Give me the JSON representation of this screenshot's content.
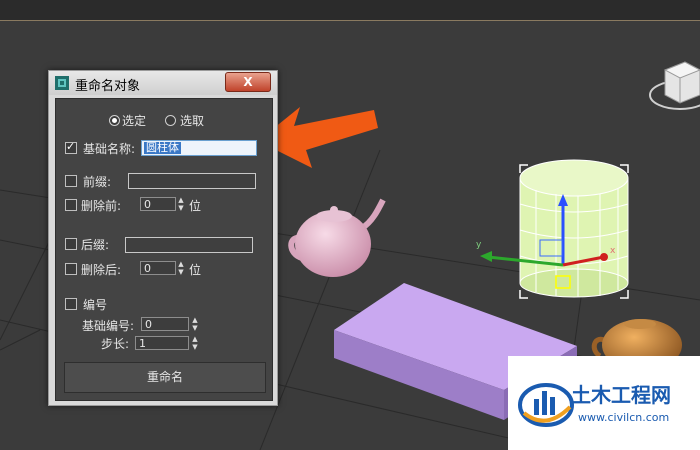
{
  "dialog": {
    "title": "重命名对象",
    "close": "X",
    "scope": {
      "selected": "选定",
      "pick": "选取"
    },
    "base_name": {
      "label": "基础名称:",
      "value": "圆柱体"
    },
    "prefix": {
      "label": "前缀:",
      "value": ""
    },
    "remove_first": {
      "label": "删除前:",
      "value": "0",
      "unit": "位"
    },
    "suffix": {
      "label": "后缀:",
      "value": ""
    },
    "remove_last": {
      "label": "删除后:",
      "value": "0",
      "unit": "位"
    },
    "numbered": {
      "label": "编号"
    },
    "base_number": {
      "label": "基础编号:",
      "value": "0"
    },
    "step": {
      "label": "步长:",
      "value": "1"
    },
    "rename_button": "重命名"
  },
  "viewport": {
    "gizmo_x": "x",
    "gizmo_y": "y"
  },
  "logo": {
    "name": "土木工程网",
    "url": "www.civilcn.com"
  },
  "colors": {
    "arrow": "#f05a14",
    "cylinder": "#d8f0a0",
    "box": "#b89ae0",
    "teapot_pink": "#e9bcd0",
    "teapot_gold": "#d08a3a",
    "logo_blue": "#1a5bb0"
  }
}
